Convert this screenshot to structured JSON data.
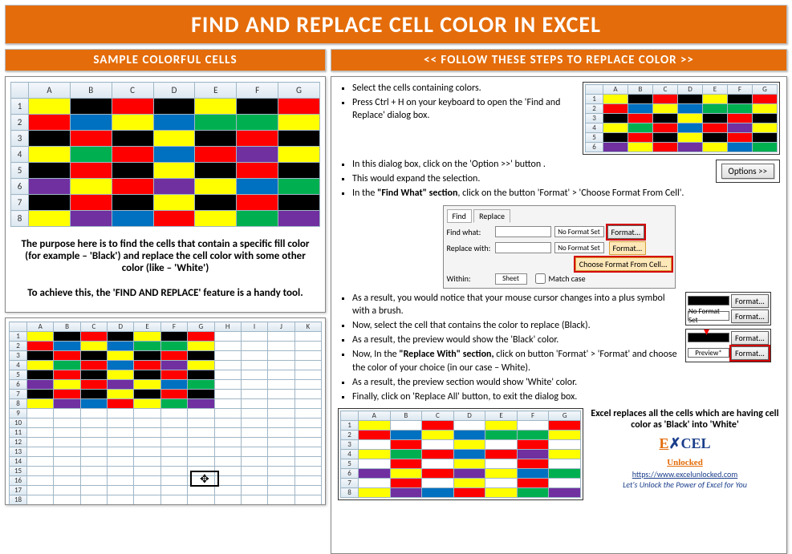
{
  "title": "FIND AND REPLACE CELL COLOR IN EXCEL",
  "left": {
    "heading": "SAMPLE COLORFUL CELLS",
    "cols": [
      "A",
      "B",
      "C",
      "D",
      "E",
      "F",
      "G"
    ],
    "rows": [
      "1",
      "2",
      "3",
      "4",
      "5",
      "6",
      "7",
      "8"
    ],
    "grid": [
      [
        "#ffff00",
        "#000000",
        "#ff0000",
        "#000000",
        "#ffff00",
        "#000000",
        "#ff0000"
      ],
      [
        "#ff0000",
        "#0070c0",
        "#ffff00",
        "#0070c0",
        "#00b050",
        "#00b050",
        "#ffff00"
      ],
      [
        "#000000",
        "#ff0000",
        "#000000",
        "#ffff00",
        "#000000",
        "#ff0000",
        "#000000"
      ],
      [
        "#ffff00",
        "#00b050",
        "#ff0000",
        "#0070c0",
        "#ff0000",
        "#7030a0",
        "#ffff00"
      ],
      [
        "#000000",
        "#ff0000",
        "#000000",
        "#ffff00",
        "#000000",
        "#ff0000",
        "#000000"
      ],
      [
        "#7030a0",
        "#ffff00",
        "#ff0000",
        "#7030a0",
        "#ffff00",
        "#0070c0",
        "#00b050"
      ],
      [
        "#000000",
        "#ff0000",
        "#000000",
        "#ffff00",
        "#000000",
        "#ff0000",
        "#000000"
      ],
      [
        "#ffff00",
        "#7030a0",
        "#0070c0",
        "#ff0000",
        "#ffff00",
        "#00b050",
        "#7030a0"
      ]
    ],
    "para1": "The purpose here is to find the cells that contain a specific fill color (for example – 'Black') and replace the cell color with some other color (like – 'White')",
    "para2": "To achieve this, the 'FIND AND REPLACE' feature is a handy tool.",
    "cols2": [
      "A",
      "B",
      "C",
      "D",
      "E",
      "F",
      "G",
      "H",
      "I",
      "J",
      "K"
    ],
    "rows2": [
      "1",
      "2",
      "3",
      "4",
      "5",
      "6",
      "7",
      "8",
      "9",
      "10",
      "11",
      "12",
      "13",
      "14",
      "15",
      "16",
      "17",
      "18"
    ]
  },
  "right": {
    "heading": "<< FOLLOW THESE STEPS TO REPLACE COLOR >>",
    "step1": "Select the cells containing colors.",
    "step2": "Press Ctrl + H on your keyboard to open the 'Find and Replace' dialog box.",
    "step3": "In this dialog box, click on the 'Option >>' button .",
    "step4": "This would expand the selection.",
    "step5a": "In the ",
    "step5b": "\"Find What\" section",
    "step5c": ", click on the button 'Format' > 'Choose Format From Cell'.",
    "step6": "As a result, you would notice that your mouse cursor changes into a plus symbol with a brush.",
    "step7": "Now, select the cell that contains the color to replace (Black).",
    "step8": "As a result, the preview would show the 'Black' color.",
    "step9a": "Now, In the ",
    "step9b": "\"Replace With\" section,",
    "step9c": " click on button 'Format' > 'Format' and choose the color of your choice (in our case – White).",
    "step10": "As a result, the preview section would show 'White' color.",
    "step11": "Finally, click on 'Replace All' button, to exit the dialog box.",
    "options_btn": "Options >>",
    "dialog": {
      "tab_find": "Find",
      "tab_replace": "Replace",
      "find_what": "Find what:",
      "replace_with": "Replace with:",
      "no_format": "No Format Set",
      "format_btn": "Format...",
      "format_menu": "Format...",
      "choose_fmt": "Choose Format From Cell...",
      "within": "Within:",
      "sheet": "Sheet",
      "match_case": "Match case"
    },
    "fmt_labels": {
      "black_prev": "",
      "nofmt": "No Format Set",
      "format": "Format...",
      "preview": "Preview*"
    },
    "result_grid_cols": [
      "A",
      "B",
      "C",
      "D",
      "E",
      "F",
      "G"
    ],
    "result_rows": [
      "1",
      "2",
      "3",
      "4",
      "5",
      "6",
      "7",
      "8"
    ],
    "result_grid": [
      [
        "#ffff00",
        "#ffffff",
        "#ff0000",
        "#ffffff",
        "#ffff00",
        "#ffffff",
        "#ff0000"
      ],
      [
        "#ff0000",
        "#0070c0",
        "#ffff00",
        "#0070c0",
        "#00b050",
        "#00b050",
        "#ffff00"
      ],
      [
        "#ffffff",
        "#ff0000",
        "#ffffff",
        "#ffff00",
        "#ffffff",
        "#ff0000",
        "#ffffff"
      ],
      [
        "#ffff00",
        "#00b050",
        "#ff0000",
        "#0070c0",
        "#ff0000",
        "#7030a0",
        "#ffff00"
      ],
      [
        "#ffffff",
        "#ff0000",
        "#ffffff",
        "#ffff00",
        "#ffffff",
        "#ff0000",
        "#ffffff"
      ],
      [
        "#7030a0",
        "#ffff00",
        "#ff0000",
        "#7030a0",
        "#ffff00",
        "#0070c0",
        "#00b050"
      ],
      [
        "#ffffff",
        "#ff0000",
        "#ffffff",
        "#ffff00",
        "#ffffff",
        "#ff0000",
        "#ffffff"
      ],
      [
        "#ffff00",
        "#7030a0",
        "#0070c0",
        "#ff0000",
        "#ffff00",
        "#00b050",
        "#7030a0"
      ]
    ],
    "summary": "Excel replaces all the cells which are having cell color as 'Black' into 'White'",
    "logo1": "E",
    "logo2": "CEL",
    "logo3": "Unlocked",
    "url": "https://www.excelunlocked.com",
    "tagline": "Let's Unlock the Power of Excel for You"
  }
}
